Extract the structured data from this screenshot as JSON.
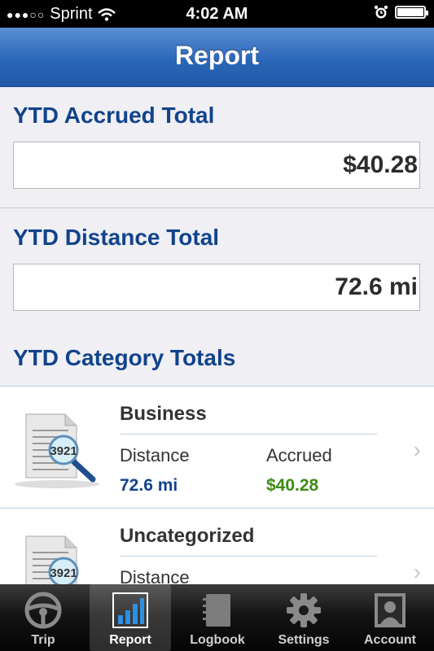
{
  "status": {
    "carrier": "Sprint",
    "time": "4:02 AM"
  },
  "nav": {
    "title": "Report"
  },
  "ytd_accrued": {
    "title": "YTD Accrued Total",
    "value": "$40.28"
  },
  "ytd_distance": {
    "title": "YTD Distance Total",
    "value": "72.6 mi"
  },
  "categories": {
    "title": "YTD Category Totals",
    "items": [
      {
        "name": "Business",
        "distance_label": "Distance",
        "accrued_label": "Accrued",
        "distance": "72.6 mi",
        "accrued": "$40.28"
      },
      {
        "name": "Uncategorized",
        "distance_label": "Distance"
      }
    ]
  },
  "thumb_text": "3921",
  "tabs": [
    {
      "label": "Trip",
      "icon": "steering-wheel-icon"
    },
    {
      "label": "Report",
      "icon": "bar-chart-icon"
    },
    {
      "label": "Logbook",
      "icon": "logbook-icon"
    },
    {
      "label": "Settings",
      "icon": "gear-icon"
    },
    {
      "label": "Account",
      "icon": "account-icon"
    }
  ],
  "colors": {
    "accent": "#11438c",
    "distance": "#11438c",
    "accrued": "#3c8a12",
    "nav_top": "#5a8fd4",
    "nav_bottom": "#1f58a8"
  }
}
